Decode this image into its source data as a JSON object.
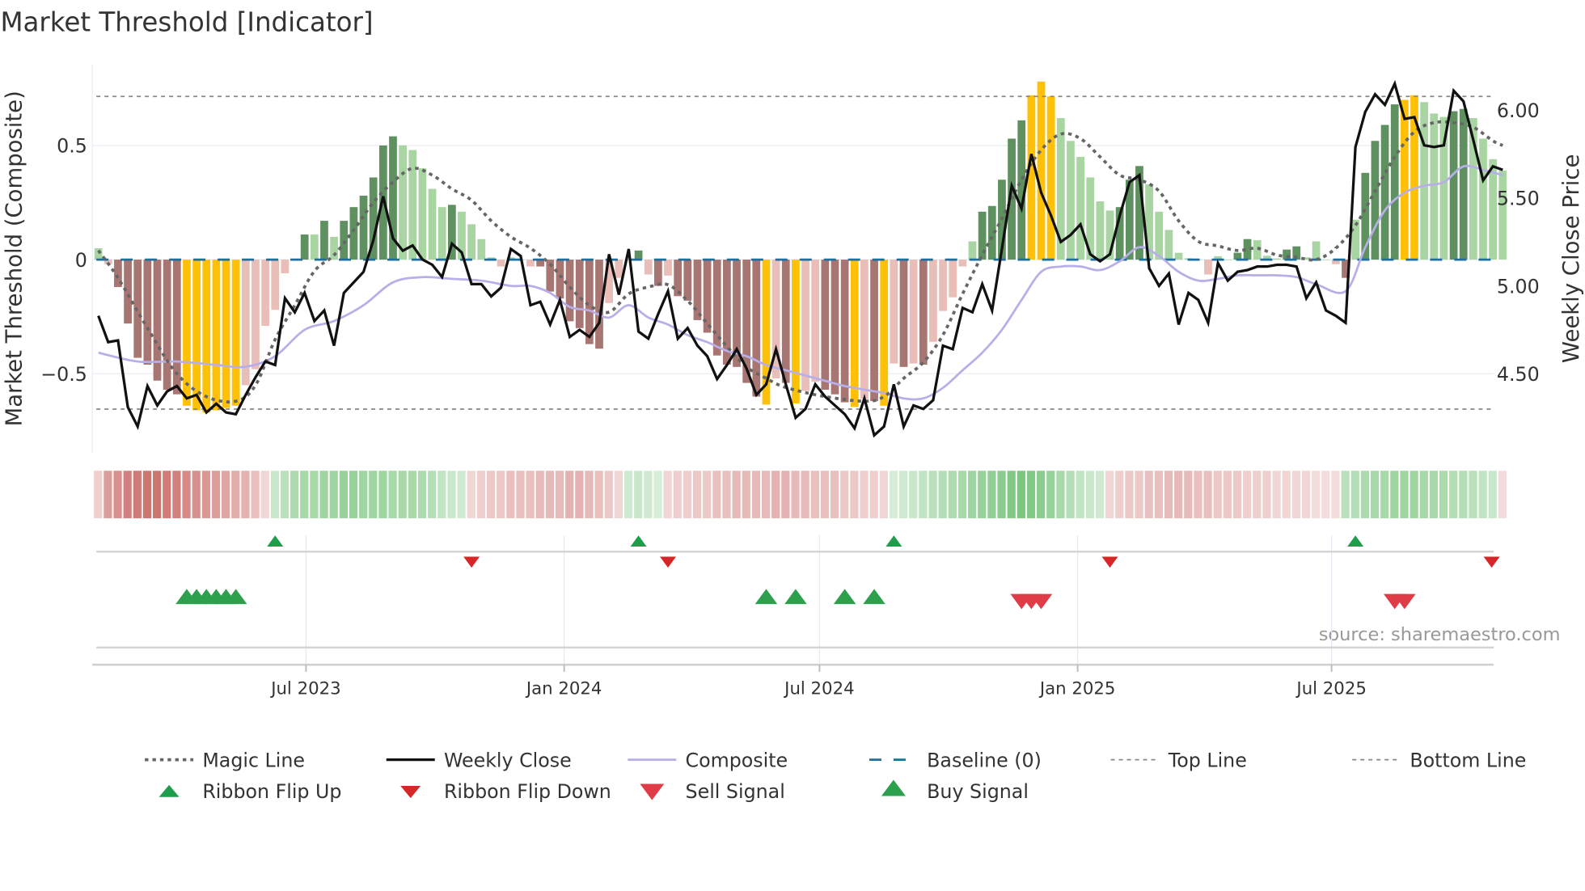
{
  "title": "Market Threshold [Indicator]",
  "source": "source: sharemaestro.com",
  "colors": {
    "dg": "#5f9160",
    "lg": "#a8d5a2",
    "dr": "#a87672",
    "lr": "#e9bdb8",
    "y": "#ffc107",
    "price": "#111111",
    "composite": "#b8aee8",
    "magic": "#666666",
    "baseline": "#1f6e9c",
    "threshold": "#888888",
    "ribbon_pos": "#5cb860",
    "ribbon_neg": "#c45a55",
    "flip_up": "#1e9e4a",
    "flip_down": "#d62728",
    "buy": "#2ca04c",
    "sell": "#e03c48"
  },
  "chart_data": {
    "type": "bar+line",
    "title": "Market Threshold [Indicator]",
    "ylabel_left": "Market Threshold (Composite)",
    "ylabel_right": "Weekly Close Price",
    "start_date": "2023-02-03",
    "frequency": "weekly",
    "ylim_left": [
      -0.85,
      0.85
    ],
    "yticks_left": [
      {
        "v": 0.5,
        "label": "0.5"
      },
      {
        "v": 0,
        "label": "0"
      },
      {
        "v": -0.5,
        "label": "−0.5"
      }
    ],
    "yticks_right": [
      {
        "v": 6.0,
        "label": "6.00"
      },
      {
        "v": 5.5,
        "label": "5.50"
      },
      {
        "v": 5.0,
        "label": "5.00"
      },
      {
        "v": 4.5,
        "label": "4.50"
      }
    ],
    "xticks": [
      {
        "date": "2023-07-01",
        "label": "Jul 2023"
      },
      {
        "date": "2024-01-01",
        "label": "Jan 2024"
      },
      {
        "date": "2024-07-01",
        "label": "Jul 2024"
      },
      {
        "date": "2025-01-01",
        "label": "Jan 2025"
      },
      {
        "date": "2025-07-01",
        "label": "Jul 2025"
      }
    ],
    "top_line": 0.715,
    "bottom_line": -0.655,
    "baseline": 0,
    "composite_bars": [
      0.05,
      -0.02,
      -0.12,
      -0.28,
      -0.43,
      -0.46,
      -0.53,
      -0.57,
      -0.59,
      -0.64,
      -0.66,
      -0.67,
      -0.66,
      -0.65,
      -0.64,
      -0.55,
      -0.48,
      -0.29,
      -0.22,
      -0.06,
      0,
      0.11,
      0.11,
      0.17,
      0.1,
      0.17,
      0.23,
      0.28,
      0.36,
      0.5,
      0.54,
      0.5,
      0.48,
      0.4,
      0.31,
      0.23,
      0.24,
      0.21,
      0.155,
      0.09,
      0.01,
      -0.03,
      0.01,
      0.0,
      -0.03,
      -0.03,
      -0.14,
      -0.17,
      -0.27,
      -0.3,
      -0.37,
      -0.39,
      -0.19,
      -0.08,
      0.0,
      0.04,
      -0.065,
      -0.115,
      -0.07,
      -0.16,
      -0.18,
      -0.265,
      -0.32,
      -0.42,
      -0.46,
      -0.47,
      -0.54,
      -0.6,
      -0.635,
      -0.52,
      -0.54,
      -0.63,
      -0.575,
      -0.535,
      -0.57,
      -0.59,
      -0.625,
      -0.645,
      -0.61,
      -0.62,
      -0.64,
      -0.455,
      -0.47,
      -0.455,
      -0.46,
      -0.36,
      -0.225,
      -0.165,
      -0.03,
      0.08,
      0.21,
      0.235,
      0.35,
      0.53,
      0.61,
      0.72,
      0.78,
      0.715,
      0.62,
      0.52,
      0.45,
      0.36,
      0.255,
      0.215,
      0.23,
      0.35,
      0.41,
      0.33,
      0.21,
      0.13,
      0.03,
      0.006,
      0.0,
      -0.065,
      0.015,
      0.0,
      0.03,
      0.09,
      0.085,
      0.017,
      0.005,
      0.044,
      0.058,
      0.01,
      0.08,
      0.0,
      -0.02,
      -0.08,
      0.175,
      0.38,
      0.52,
      0.59,
      0.68,
      0.7,
      0.72,
      0.69,
      0.64,
      0.625,
      0.65,
      0.66,
      0.62,
      0.53,
      0.44,
      0.39
    ],
    "bar_colors": [
      "lg",
      "lr",
      "dr",
      "dr",
      "dr",
      "dr",
      "dr",
      "dr",
      "dr",
      "y",
      "y",
      "y",
      "y",
      "y",
      "y",
      "lr",
      "lr",
      "lr",
      "lr",
      "lr",
      "lr",
      "dg",
      "lg",
      "dg",
      "lg",
      "dg",
      "dg",
      "dg",
      "dg",
      "dg",
      "dg",
      "lg",
      "lg",
      "lg",
      "lg",
      "lg",
      "dg",
      "lg",
      "lg",
      "lg",
      "lg",
      "lr",
      "lg",
      "lg",
      "lr",
      "dr",
      "dr",
      "dr",
      "dr",
      "dr",
      "dr",
      "dr",
      "lr",
      "lr",
      "lg",
      "dg",
      "lr",
      "dr",
      "lr",
      "dr",
      "dr",
      "dr",
      "dr",
      "dr",
      "dr",
      "dr",
      "dr",
      "dr",
      "y",
      "lr",
      "dr",
      "y",
      "lr",
      "lr",
      "dr",
      "dr",
      "dr",
      "y",
      "lr",
      "dr",
      "y",
      "lr",
      "dr",
      "lr",
      "dr",
      "lr",
      "lr",
      "lr",
      "lr",
      "lg",
      "dg",
      "dg",
      "dg",
      "dg",
      "dg",
      "y",
      "y",
      "y",
      "lg",
      "lg",
      "lg",
      "lg",
      "lg",
      "lg",
      "dg",
      "dg",
      "dg",
      "lg",
      "lg",
      "lg",
      "lg",
      "lg",
      "lg",
      "lr",
      "lg",
      "lg",
      "dg",
      "dg",
      "lg",
      "lg",
      "lg",
      "dg",
      "dg",
      "lg",
      "lg",
      "lg",
      "lr",
      "dr",
      "lg",
      "dg",
      "dg",
      "dg",
      "dg",
      "y",
      "y",
      "lg",
      "lg",
      "lg",
      "dg",
      "dg",
      "lg",
      "lg",
      "lg",
      "lg"
    ],
    "weekly_close": [
      4.83,
      4.68,
      4.69,
      4.31,
      4.2,
      4.43,
      4.32,
      4.4,
      4.43,
      4.36,
      4.38,
      4.28,
      4.33,
      4.28,
      4.27,
      4.38,
      4.48,
      4.57,
      4.55,
      4.93,
      4.85,
      4.96,
      4.8,
      4.86,
      4.66,
      4.96,
      5.02,
      5.08,
      5.26,
      5.51,
      5.27,
      5.2,
      5.23,
      5.15,
      5.12,
      5.05,
      5.24,
      5.19,
      5.01,
      5.01,
      4.94,
      4.99,
      5.21,
      5.17,
      4.89,
      4.91,
      4.78,
      4.92,
      4.71,
      4.75,
      4.71,
      4.79,
      5.18,
      4.95,
      5.21,
      4.74,
      4.7,
      4.84,
      4.97,
      4.7,
      4.76,
      4.66,
      4.6,
      4.47,
      4.55,
      4.64,
      4.53,
      4.38,
      4.44,
      4.64,
      4.44,
      4.25,
      4.3,
      4.44,
      4.37,
      4.32,
      4.27,
      4.19,
      4.36,
      4.15,
      4.2,
      4.44,
      4.2,
      4.32,
      4.3,
      4.35,
      4.66,
      4.64,
      4.875,
      4.85,
      5.01,
      4.86,
      5.21,
      5.57,
      5.44,
      5.75,
      5.53,
      5.4,
      5.25,
      5.29,
      5.35,
      5.18,
      5.14,
      5.18,
      5.4,
      5.59,
      5.63,
      5.1,
      5.0,
      5.07,
      4.78,
      4.96,
      4.92,
      4.79,
      5.13,
      5.03,
      5.08,
      5.09,
      5.11,
      5.11,
      5.12,
      5.12,
      5.11,
      4.93,
      5.02,
      4.86,
      4.83,
      4.79,
      5.79,
      5.99,
      6.09,
      6.03,
      6.15,
      5.95,
      5.96,
      5.8,
      5.79,
      5.8,
      6.11,
      6.05,
      5.83,
      5.6,
      5.68,
      5.66
    ],
    "magic_line": [
      [
        0,
        0.04
      ],
      [
        2,
        -0.08
      ],
      [
        5,
        -0.3
      ],
      [
        8,
        -0.5
      ],
      [
        11,
        -0.6
      ],
      [
        14,
        -0.62
      ],
      [
        16,
        -0.55
      ],
      [
        18,
        -0.35
      ],
      [
        20,
        -0.2
      ],
      [
        22,
        -0.05
      ],
      [
        24,
        0.02
      ],
      [
        26,
        0.13
      ],
      [
        28,
        0.25
      ],
      [
        30,
        0.34
      ],
      [
        32,
        0.4
      ],
      [
        34,
        0.37
      ],
      [
        36,
        0.31
      ],
      [
        38,
        0.26
      ],
      [
        40,
        0.17
      ],
      [
        42,
        0.1
      ],
      [
        44,
        0.05
      ],
      [
        46,
        -0.02
      ],
      [
        48,
        -0.12
      ],
      [
        50,
        -0.2
      ],
      [
        52,
        -0.23
      ],
      [
        54,
        -0.15
      ],
      [
        56,
        -0.12
      ],
      [
        58,
        -0.11
      ],
      [
        60,
        -0.18
      ],
      [
        62,
        -0.28
      ],
      [
        64,
        -0.38
      ],
      [
        66,
        -0.47
      ],
      [
        68,
        -0.52
      ],
      [
        70,
        -0.56
      ],
      [
        74,
        -0.6
      ],
      [
        78,
        -0.62
      ],
      [
        80,
        -0.6
      ],
      [
        82,
        -0.52
      ],
      [
        84,
        -0.45
      ],
      [
        86,
        -0.33
      ],
      [
        88,
        -0.15
      ],
      [
        90,
        0.02
      ],
      [
        92,
        0.18
      ],
      [
        94,
        0.35
      ],
      [
        96,
        0.48
      ],
      [
        98,
        0.55
      ],
      [
        100,
        0.53
      ],
      [
        102,
        0.45
      ],
      [
        104,
        0.37
      ],
      [
        106,
        0.35
      ],
      [
        108,
        0.3
      ],
      [
        110,
        0.17
      ],
      [
        112,
        0.08
      ],
      [
        114,
        0.06
      ],
      [
        116,
        0.04
      ],
      [
        118,
        0.05
      ],
      [
        120,
        0.02
      ],
      [
        122,
        0.01
      ],
      [
        124,
        0.0
      ],
      [
        126,
        0.05
      ],
      [
        128,
        0.15
      ],
      [
        130,
        0.3
      ],
      [
        132,
        0.45
      ],
      [
        134,
        0.56
      ],
      [
        136,
        0.6
      ],
      [
        138,
        0.6
      ],
      [
        140,
        0.58
      ],
      [
        142,
        0.52
      ],
      [
        143,
        0.5
      ]
    ],
    "composite_line": [
      [
        0,
        4.62
      ],
      [
        4,
        4.57
      ],
      [
        8,
        4.57
      ],
      [
        12,
        4.55
      ],
      [
        15,
        4.54
      ],
      [
        18,
        4.6
      ],
      [
        21,
        4.75
      ],
      [
        24,
        4.8
      ],
      [
        27,
        4.89
      ],
      [
        30,
        5.02
      ],
      [
        33,
        5.05
      ],
      [
        36,
        5.04
      ],
      [
        39,
        5.03
      ],
      [
        42,
        5.0
      ],
      [
        44,
        5.0
      ],
      [
        46,
        4.96
      ],
      [
        48,
        4.88
      ],
      [
        50,
        4.86
      ],
      [
        52,
        4.82
      ],
      [
        54,
        4.89
      ],
      [
        56,
        4.82
      ],
      [
        58,
        4.78
      ],
      [
        60,
        4.72
      ],
      [
        62,
        4.68
      ],
      [
        64,
        4.63
      ],
      [
        66,
        4.6
      ],
      [
        68,
        4.55
      ],
      [
        70,
        4.52
      ],
      [
        72,
        4.49
      ],
      [
        74,
        4.46
      ],
      [
        76,
        4.43
      ],
      [
        78,
        4.41
      ],
      [
        80,
        4.39
      ],
      [
        82,
        4.36
      ],
      [
        84,
        4.36
      ],
      [
        86,
        4.42
      ],
      [
        88,
        4.52
      ],
      [
        90,
        4.62
      ],
      [
        92,
        4.75
      ],
      [
        94,
        4.92
      ],
      [
        96,
        5.08
      ],
      [
        98,
        5.11
      ],
      [
        100,
        5.11
      ],
      [
        102,
        5.09
      ],
      [
        104,
        5.14
      ],
      [
        106,
        5.22
      ],
      [
        108,
        5.17
      ],
      [
        110,
        5.08
      ],
      [
        112,
        5.03
      ],
      [
        114,
        5.04
      ],
      [
        116,
        5.06
      ],
      [
        118,
        5.06
      ],
      [
        120,
        5.06
      ],
      [
        122,
        5.05
      ],
      [
        124,
        5.01
      ],
      [
        127,
        4.97
      ],
      [
        129,
        5.22
      ],
      [
        131,
        5.43
      ],
      [
        133,
        5.53
      ],
      [
        135,
        5.57
      ],
      [
        137,
        5.59
      ],
      [
        139,
        5.68
      ],
      [
        141,
        5.66
      ],
      [
        143,
        5.63
      ]
    ],
    "ribbon": [
      -0.2,
      -0.55,
      -0.65,
      -0.75,
      -0.8,
      -0.85,
      -0.85,
      -0.8,
      -0.75,
      -0.7,
      -0.65,
      -0.6,
      -0.55,
      -0.5,
      -0.45,
      -0.4,
      -0.3,
      -0.15,
      0.25,
      0.35,
      0.45,
      0.5,
      0.5,
      0.55,
      0.55,
      0.6,
      0.6,
      0.55,
      0.55,
      0.55,
      0.5,
      0.5,
      0.5,
      0.45,
      0.4,
      0.3,
      0.25,
      0.2,
      -0.15,
      -0.2,
      -0.25,
      -0.25,
      -0.3,
      -0.3,
      -0.3,
      -0.35,
      -0.35,
      -0.35,
      -0.4,
      -0.4,
      -0.35,
      -0.3,
      -0.25,
      -0.15,
      0.2,
      0.25,
      0.2,
      0.15,
      -0.15,
      -0.2,
      -0.2,
      -0.25,
      -0.25,
      -0.3,
      -0.3,
      -0.35,
      -0.35,
      -0.35,
      -0.35,
      -0.4,
      -0.4,
      -0.35,
      -0.35,
      -0.3,
      -0.3,
      -0.3,
      -0.25,
      -0.25,
      -0.2,
      -0.2,
      -0.15,
      0.15,
      0.2,
      0.25,
      0.3,
      0.35,
      0.4,
      0.45,
      0.5,
      0.55,
      0.6,
      0.65,
      0.7,
      0.75,
      0.8,
      0.75,
      0.7,
      0.6,
      0.5,
      0.4,
      0.3,
      0.25,
      0.2,
      -0.15,
      -0.2,
      -0.25,
      -0.25,
      -0.3,
      -0.3,
      -0.35,
      -0.35,
      -0.35,
      -0.3,
      -0.3,
      -0.25,
      -0.25,
      -0.25,
      -0.2,
      -0.2,
      -0.2,
      -0.15,
      -0.15,
      -0.15,
      -0.15,
      -0.1,
      -0.1,
      -0.1,
      0.35,
      0.4,
      0.45,
      0.5,
      0.5,
      0.55,
      0.55,
      0.55,
      0.5,
      0.5,
      0.45,
      0.4,
      0.4,
      0.35,
      0.3,
      0.25,
      -0.12
    ],
    "ribbon_flip_up": [
      "2023-06-09",
      "2024-02-23",
      "2024-08-23",
      "2025-07-18"
    ],
    "ribbon_flip_down": [
      "2023-10-27",
      "2024-03-15",
      "2025-01-24",
      "2025-10-24"
    ],
    "buy_signals": [
      "2023-04-07",
      "2023-04-14",
      "2023-04-21",
      "2023-04-28",
      "2023-05-05",
      "2023-05-12",
      "2024-05-24",
      "2024-06-14",
      "2024-07-19",
      "2024-08-09"
    ],
    "sell_signals": [
      "2024-11-22",
      "2024-11-29",
      "2024-12-06",
      "2025-08-15",
      "2025-08-22"
    ],
    "legend": [
      {
        "key": "magic",
        "label": "Magic Line"
      },
      {
        "key": "price",
        "label": "Weekly Close"
      },
      {
        "key": "composite",
        "label": "Composite"
      },
      {
        "key": "baseline",
        "label": "Baseline (0)"
      },
      {
        "key": "top",
        "label": "Top Line"
      },
      {
        "key": "bottom",
        "label": "Bottom Line"
      },
      {
        "key": "flip_up",
        "label": "Ribbon Flip Up"
      },
      {
        "key": "flip_down",
        "label": "Ribbon Flip Down"
      },
      {
        "key": "sell",
        "label": "Sell Signal"
      },
      {
        "key": "buy",
        "label": "Buy Signal"
      }
    ],
    "legend_placement": "bottom"
  }
}
